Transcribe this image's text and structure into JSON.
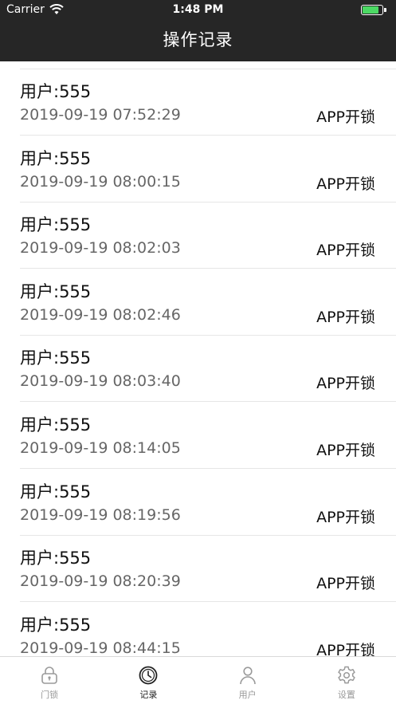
{
  "status_bar": {
    "carrier": "Carrier",
    "time": "1:48 PM"
  },
  "header": {
    "title": "操作记录"
  },
  "records": [
    {
      "user": "用户:555",
      "time": "2019-09-19 07:52:29",
      "action": "APP开锁"
    },
    {
      "user": "用户:555",
      "time": "2019-09-19 08:00:15",
      "action": "APP开锁"
    },
    {
      "user": "用户:555",
      "time": "2019-09-19 08:02:03",
      "action": "APP开锁"
    },
    {
      "user": "用户:555",
      "time": "2019-09-19 08:02:46",
      "action": "APP开锁"
    },
    {
      "user": "用户:555",
      "time": "2019-09-19 08:03:40",
      "action": "APP开锁"
    },
    {
      "user": "用户:555",
      "time": "2019-09-19 08:14:05",
      "action": "APP开锁"
    },
    {
      "user": "用户:555",
      "time": "2019-09-19 08:19:56",
      "action": "APP开锁"
    },
    {
      "user": "用户:555",
      "time": "2019-09-19 08:20:39",
      "action": "APP开锁"
    },
    {
      "user": "用户:555",
      "time": "2019-09-19 08:44:15",
      "action": "APP开锁"
    }
  ],
  "tabbar": {
    "items": [
      {
        "label": "门锁",
        "icon": "lock-icon",
        "active": false
      },
      {
        "label": "记录",
        "icon": "clock-icon",
        "active": true
      },
      {
        "label": "用户",
        "icon": "user-icon",
        "active": false
      },
      {
        "label": "设置",
        "icon": "gear-icon",
        "active": false
      }
    ]
  },
  "colors": {
    "header_bg": "#262626",
    "battery": "#4cd964",
    "inactive": "#999999",
    "active": "#222222"
  }
}
